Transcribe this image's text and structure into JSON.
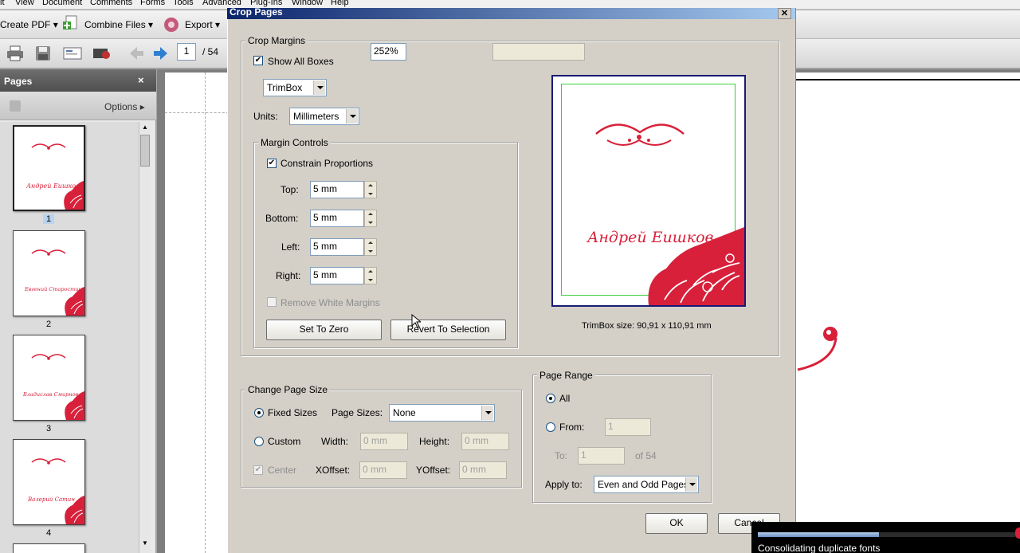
{
  "menu": {
    "items": [
      "it",
      "View",
      "Document",
      "Comments",
      "Forms",
      "Tools",
      "Advanced",
      "Plug-Ins",
      "Window",
      "Help"
    ]
  },
  "toolbar": {
    "create_pdf": "Create PDF",
    "combine_files": "Combine Files",
    "export": "Export",
    "page_current": "1",
    "page_total": "/ 54"
  },
  "pages_panel": {
    "title": "Pages",
    "options_label": "Options",
    "thumbnails": [
      {
        "number": "1",
        "name_text": "Андрей Еишков"
      },
      {
        "number": "2",
        "name_text": "Евгений Старостин"
      },
      {
        "number": "3",
        "name_text": "Владислав Смирнов"
      },
      {
        "number": "4",
        "name_text": "Валерий Сатин"
      }
    ]
  },
  "dialog": {
    "title": "Crop Pages",
    "crop_margins": {
      "legend": "Crop Margins",
      "show_all_boxes": "Show All Boxes",
      "show_all_boxes_checked": true,
      "zoom": "252%",
      "box_select": "TrimBox",
      "units_label": "Units:",
      "units_value": "Millimeters"
    },
    "margin_controls": {
      "legend": "Margin Controls",
      "constrain_proportions": "Constrain Proportions",
      "constrain_checked": true,
      "top_label": "Top:",
      "top_value": "5 mm",
      "bottom_label": "Bottom:",
      "bottom_value": "5 mm",
      "left_label": "Left:",
      "left_value": "5 mm",
      "right_label": "Right:",
      "right_value": "5 mm",
      "remove_white_margins": "Remove White Margins",
      "set_to_zero": "Set To Zero",
      "revert_to_selection": "Revert To Selection"
    },
    "preview": {
      "name_text": "Андрей Еишков",
      "size_caption": "TrimBox size: 90,91 x 110,91 mm"
    },
    "change_page_size": {
      "legend": "Change Page Size",
      "fixed_sizes": "Fixed Sizes",
      "page_sizes_label": "Page Sizes:",
      "page_sizes_value": "None",
      "custom": "Custom",
      "width_label": "Width:",
      "width_value": "0 mm",
      "height_label": "Height:",
      "height_value": "0 mm",
      "center": "Center",
      "xoffset_label": "XOffset:",
      "xoffset_value": "0 mm",
      "yoffset_label": "YOffset:",
      "yoffset_value": "0 mm"
    },
    "page_range": {
      "legend": "Page Range",
      "all": "All",
      "from": "From:",
      "from_value": "1",
      "to": "To:",
      "to_value": "1",
      "of": "of 54",
      "apply_to_label": "Apply to:",
      "apply_to_value": "Even and Odd Pages"
    },
    "ok": "OK",
    "cancel": "Cancel"
  },
  "toast": {
    "text": "Consolidating duplicate fonts",
    "progress": 0.47
  },
  "colors": {
    "accent_red": "#d8203a",
    "title_blue": "#0a246a",
    "preview_border": "#171b75",
    "crop_line": "#39d039"
  }
}
